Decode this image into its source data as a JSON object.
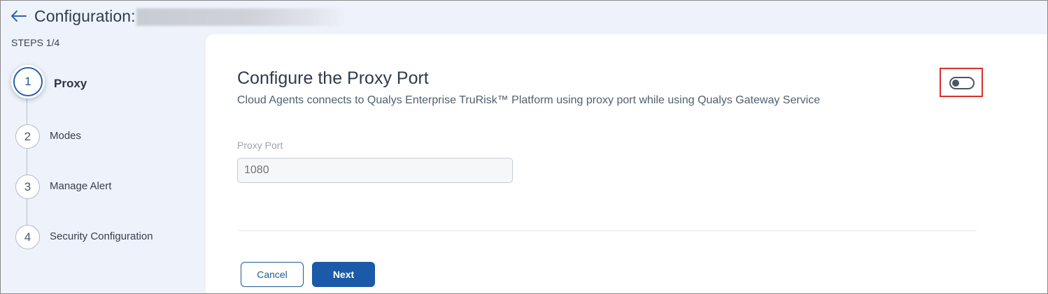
{
  "header": {
    "back_icon": "arrow-left-icon",
    "title": "Configuration:"
  },
  "sidebar": {
    "steps_count": "STEPS 1/4",
    "steps": [
      {
        "number": "1",
        "label": "Proxy",
        "active": true
      },
      {
        "number": "2",
        "label": "Modes",
        "active": false
      },
      {
        "number": "3",
        "label": "Manage Alert",
        "active": false
      },
      {
        "number": "4",
        "label": "Security Configuration",
        "active": false
      }
    ]
  },
  "main": {
    "title": "Configure the Proxy Port",
    "description": "Cloud Agents connects to Qualys Enterprise TruRisk™ Platform using proxy port while using Qualys Gateway Service",
    "toggle": {
      "state": "off",
      "highlight_color": "#d9302a"
    },
    "proxy_port": {
      "label": "Proxy Port",
      "placeholder": "1080",
      "value": ""
    },
    "buttons": {
      "cancel": "Cancel",
      "next": "Next"
    }
  },
  "colors": {
    "accent": "#1a5aa8",
    "sidebar_bg": "#eef2fa",
    "highlight": "#d9302a"
  }
}
